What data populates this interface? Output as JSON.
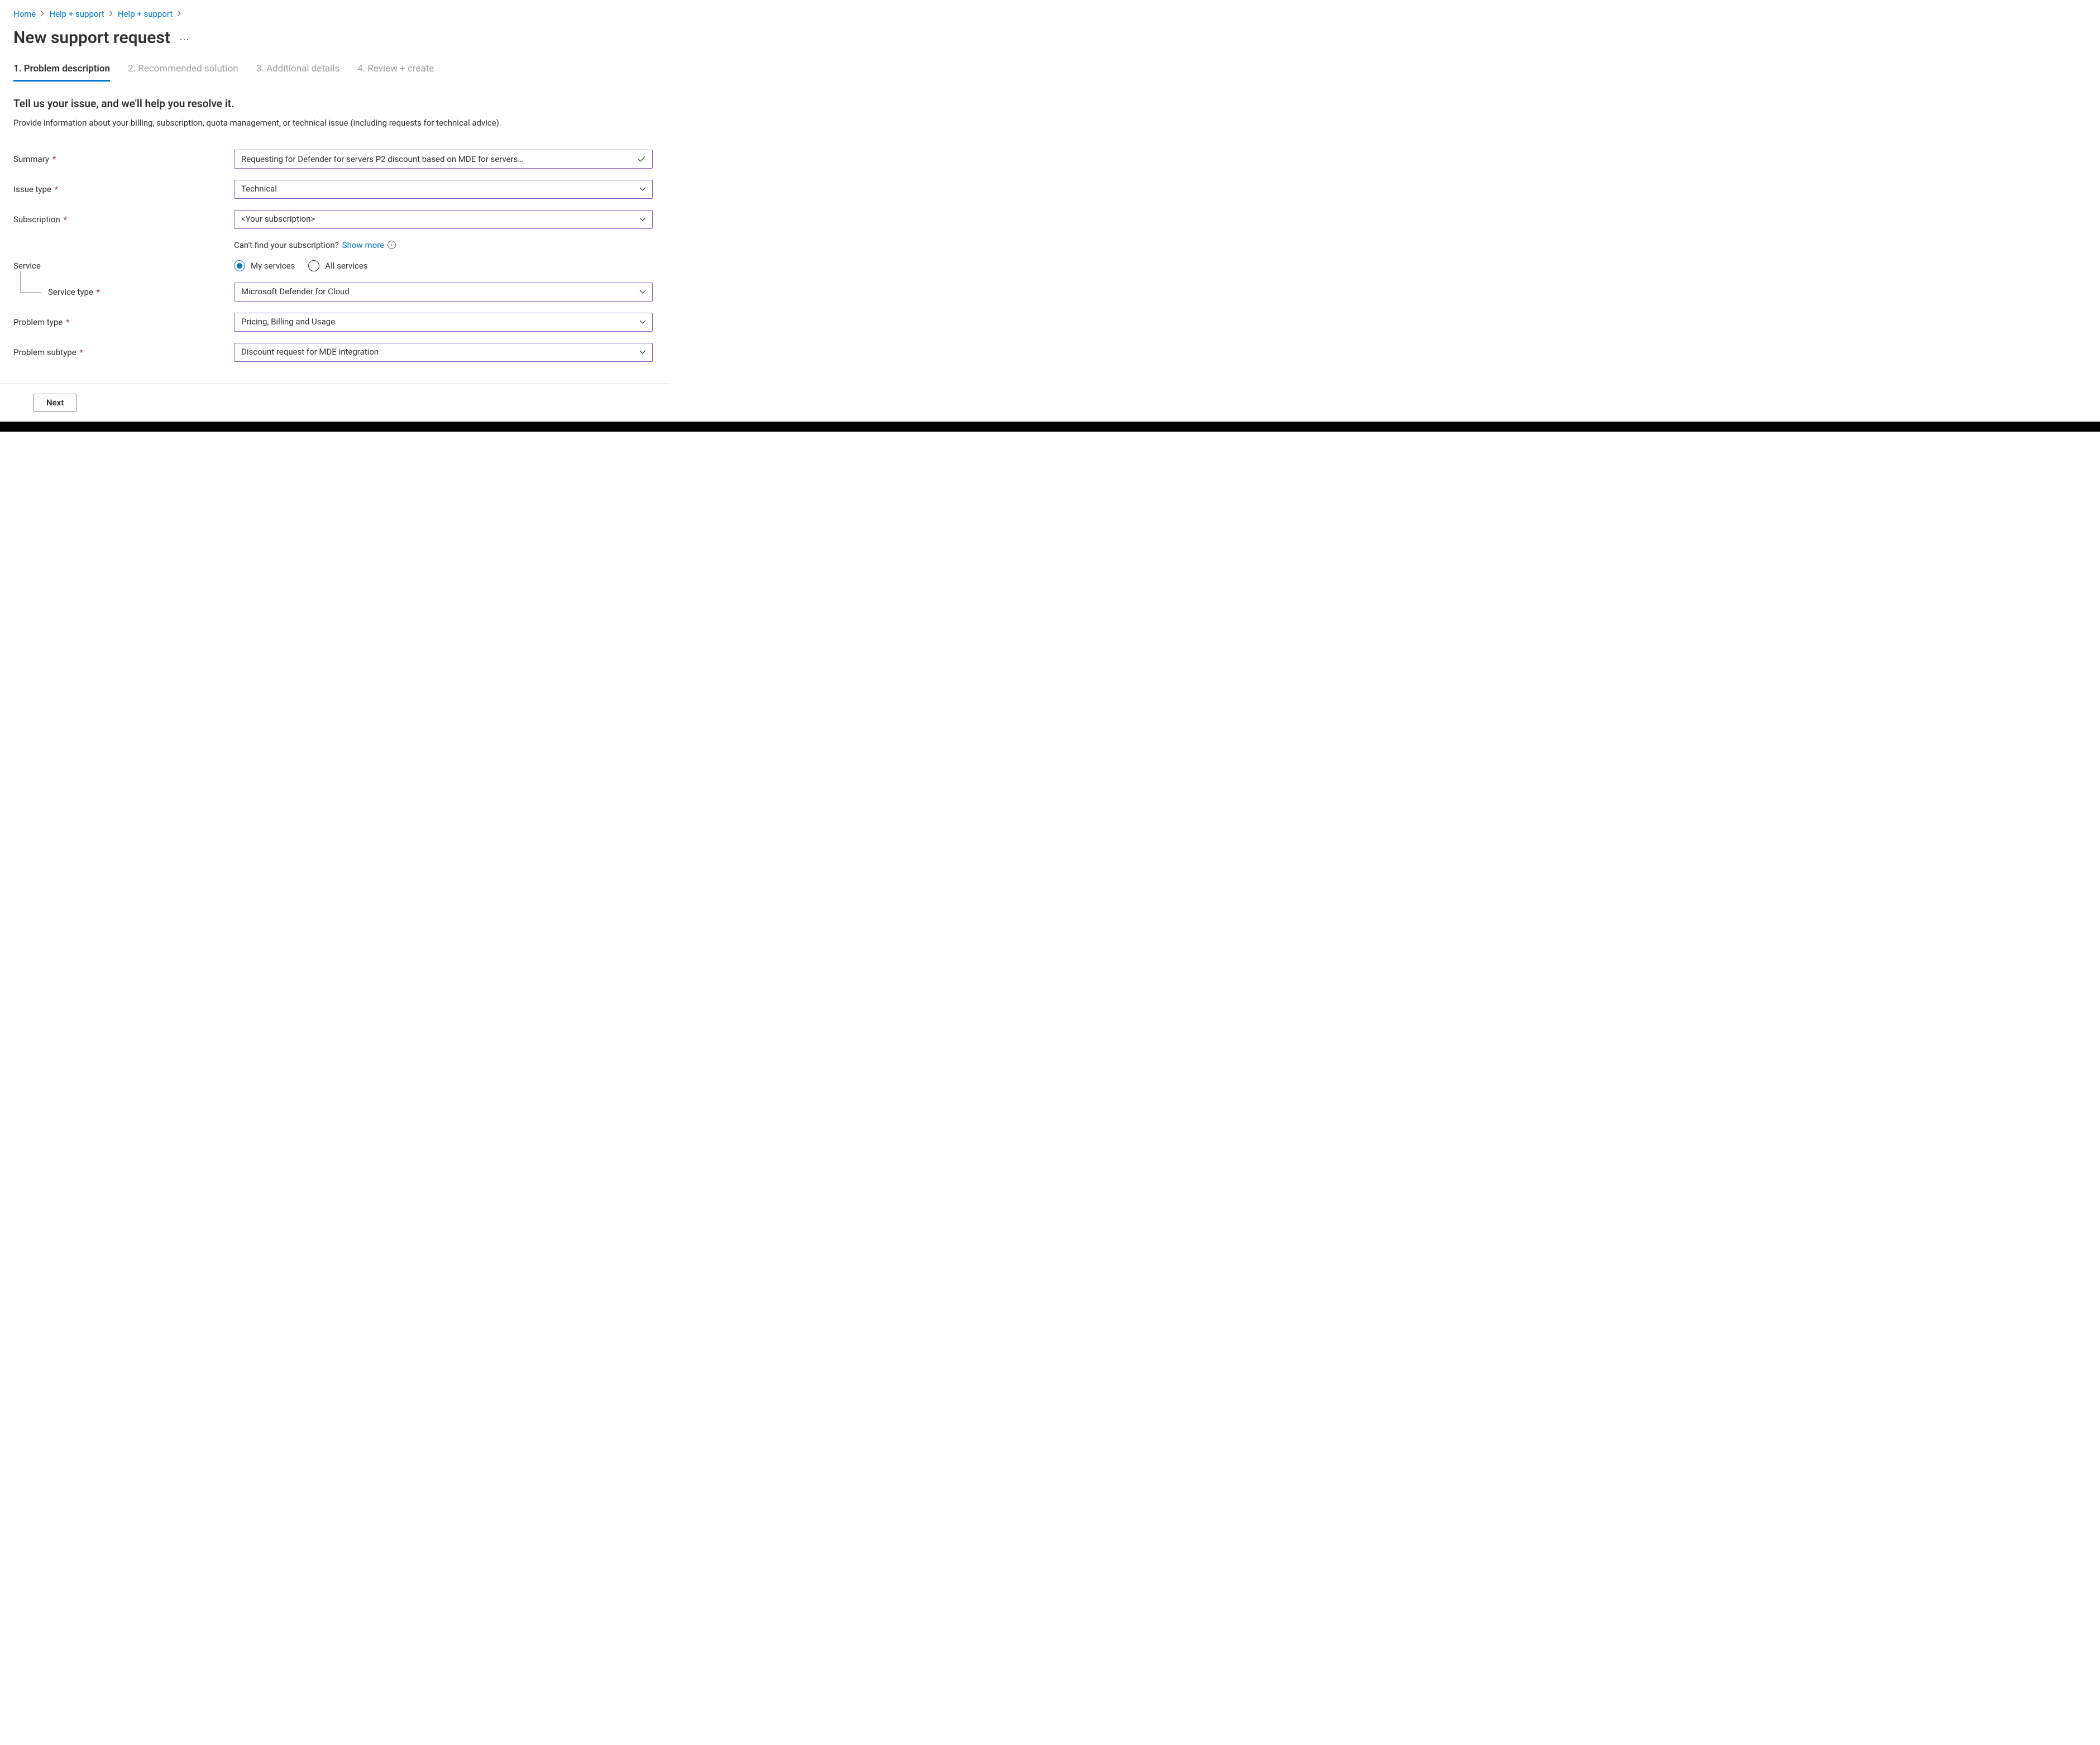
{
  "breadcrumb": {
    "items": [
      {
        "label": "Home"
      },
      {
        "label": "Help + support"
      },
      {
        "label": "Help + support"
      }
    ]
  },
  "page": {
    "title": "New support request"
  },
  "tabs": {
    "items": [
      {
        "label": "1. Problem description",
        "active": true
      },
      {
        "label": "2. Recommended solution",
        "active": false
      },
      {
        "label": "3. Additional details",
        "active": false
      },
      {
        "label": "4. Review + create",
        "active": false
      }
    ]
  },
  "section": {
    "heading": "Tell us your issue, and we'll help you resolve it.",
    "description": "Provide information about your billing, subscription, quota management, or technical issue (including requests for technical advice)."
  },
  "form": {
    "summary": {
      "label": "Summary",
      "value": "Requesting for Defender for servers P2 discount based on MDE for servers…"
    },
    "issue_type": {
      "label": "Issue type",
      "value": "Technical"
    },
    "subscription": {
      "label": "Subscription",
      "value": "<Your subscription>"
    },
    "subscription_helper": {
      "prefix": "Can't find your subscription? ",
      "link": "Show more"
    },
    "service": {
      "label": "Service",
      "options": {
        "my": "My services",
        "all": "All services"
      }
    },
    "service_type": {
      "label": "Service type",
      "value": "Microsoft Defender for Cloud"
    },
    "problem_type": {
      "label": "Problem type",
      "value": "Pricing, Billing and Usage"
    },
    "problem_subtype": {
      "label": "Problem subtype",
      "value": "Discount request for MDE integration"
    }
  },
  "footer": {
    "next": "Next"
  }
}
